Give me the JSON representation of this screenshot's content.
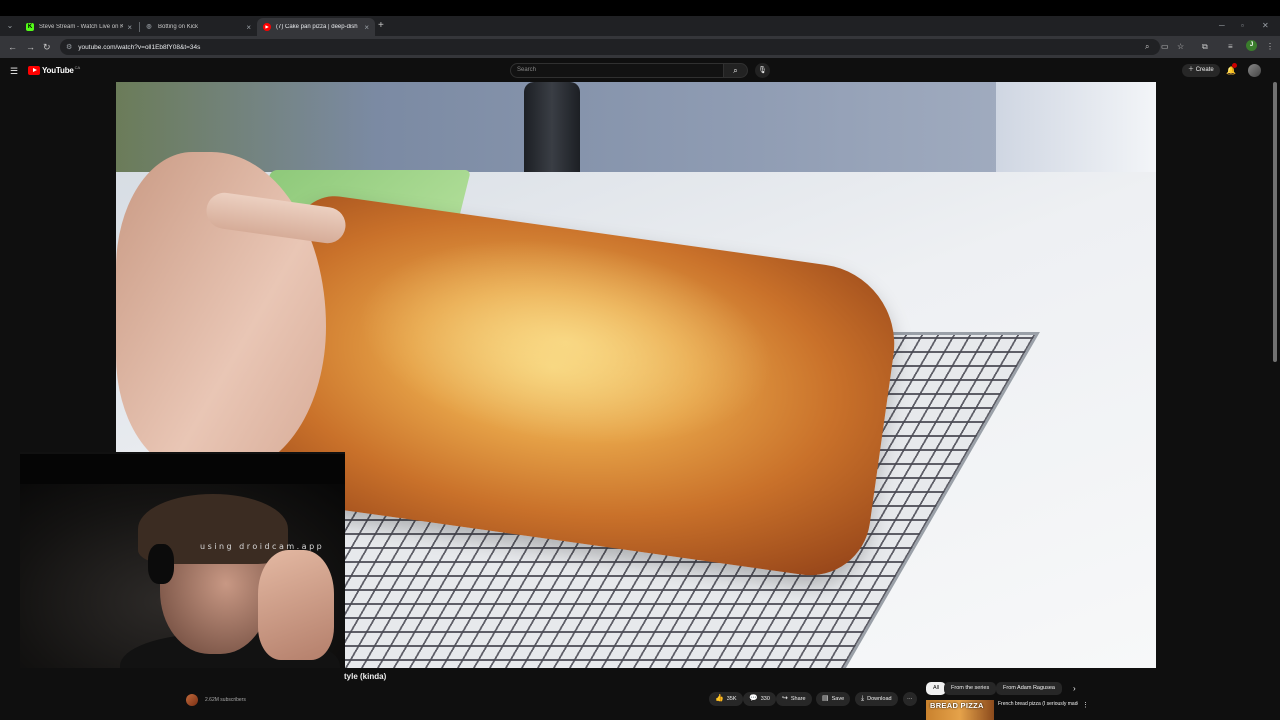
{
  "browser": {
    "tabs": [
      {
        "label": "Steve Stream - Watch Live on K",
        "favicon_color": "#53fc18",
        "favicon_glyph": "K",
        "active": false
      },
      {
        "label": "Botting on Kick",
        "favicon_color": "#9aa0a6",
        "favicon_glyph": "◎",
        "active": false
      },
      {
        "label": "(7) Cake pan pizza | deep-dish",
        "favicon_color": "#ff0000",
        "favicon_glyph": "▶",
        "active": true
      }
    ],
    "new_tab": "+",
    "url": "youtube.com/watch?v=oll1Eb8fY08&t=34s",
    "profile_initial": "J"
  },
  "youtube": {
    "logo": "YouTube",
    "region": "CA",
    "search_placeholder": "Search",
    "create_label": "Create"
  },
  "video": {
    "title_visible": "tyle (kinda)",
    "webcam_overlay_text": "using droidcam.app",
    "channel_subscribers": "2.62M subscribers",
    "actions": {
      "likes": "35K",
      "comments": "330",
      "share": "Share",
      "save": "Save",
      "download": "Download",
      "more": "···"
    }
  },
  "sidebar": {
    "chips": [
      "All",
      "From the series",
      "From Adam Ragusea"
    ],
    "next_icon": "›",
    "recommendation": {
      "thumb_text": "BREAD PIZZA",
      "title": "French bread pizza (I seriously made a video about..."
    }
  }
}
